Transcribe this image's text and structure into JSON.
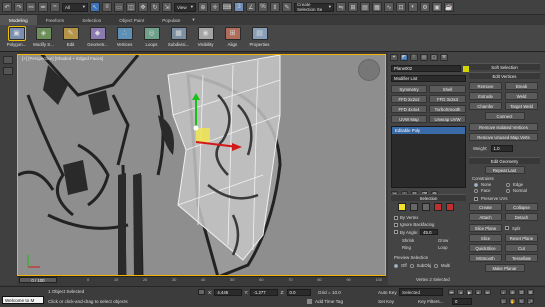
{
  "toolbar": {
    "filter_value": "All",
    "view_value": "View",
    "selection_set_value": "Create Selection Se",
    "filter_arrow": "▾",
    "view_arrow": "▾",
    "selection_arrow": "▾"
  },
  "ribbon_tabs": [
    "Modeling",
    "Freeform",
    "Selection",
    "Object Paint",
    "Populate"
  ],
  "ribbon_buttons": [
    {
      "label": "Polygon...",
      "icon": "polygon-modeling-icon",
      "color": "#7a8fb0",
      "glyph": "▣"
    },
    {
      "label": "Modify S...",
      "icon": "modify-selection-icon",
      "color": "#6d8f5a",
      "glyph": "◈"
    },
    {
      "label": "Edit",
      "icon": "edit-icon",
      "color": "#b59448",
      "glyph": "✎"
    },
    {
      "label": "Geometr...",
      "icon": "geometry-icon",
      "color": "#8a7ab0",
      "glyph": "◆"
    },
    {
      "label": "Vertices",
      "icon": "vertices-icon",
      "color": "#5e8fb5",
      "glyph": "∴"
    },
    {
      "label": "Loops",
      "icon": "loops-icon",
      "color": "#6fa08a",
      "glyph": "◎"
    },
    {
      "label": "Subdivisi...",
      "icon": "subdivision-icon",
      "color": "#7b8fa0",
      "glyph": "▦"
    },
    {
      "label": "Visibility",
      "icon": "visibility-icon",
      "color": "#a5a5a5",
      "glyph": "◉"
    },
    {
      "label": "Align",
      "icon": "align-icon",
      "color": "#b06d5a",
      "glyph": "⊞"
    },
    {
      "label": "Properties",
      "icon": "properties-icon",
      "color": "#8aa0b8",
      "glyph": "▤"
    }
  ],
  "viewport": {
    "label": "[+] [Perspective] [Shaded + Edged Faces]",
    "accent": "#f2b400"
  },
  "panel": {
    "object_name": "Plane002",
    "object_color": "#d4d400",
    "modifier_list": "Modifier List",
    "modifier_buttons": [
      "Symmetry",
      "Shell",
      "FFD 2x2x2",
      "FFD 3x3x3",
      "FFD 4x4x4",
      "TurboSmooth",
      "UVW Map",
      "Unwrap UVW"
    ],
    "stack_item": "Editable Poly",
    "selection_title": "Selection",
    "by_vertex": "By Vertex",
    "ignore_backfacing": "Ignore Backfacing",
    "by_angle": "By Angle:",
    "by_angle_value": "45.0",
    "shrink": "Shrink",
    "grow": "Grow",
    "ring": "Ring",
    "loop": "Loop",
    "preview_selection": "Preview Selection",
    "preview_off": "Off",
    "preview_subobj": "SubObj",
    "preview_multi": "Multi",
    "status": "Vertex 2 Selected",
    "soft_selection": "Soft Selection",
    "edit_vertices": "Edit Vertices",
    "remove": "Remove",
    "break": "Break",
    "extrude": "Extrude",
    "weld": "Weld",
    "chamfer": "Chamfer",
    "target_weld": "Target Weld",
    "connect": "Connect",
    "remove_isolated": "Remove Isolated Vertices",
    "remove_unused": "Remove Unused Map Verts",
    "weight_label": "Weight:",
    "weight_value": "1.0",
    "edit_geometry": "Edit Geometry",
    "repeat_last": "Repeat Last",
    "constraints": "Constraints",
    "c_none": "None",
    "c_edge": "Edge",
    "c_face": "Face",
    "c_normal": "Normal",
    "preserve_uvs": "Preserve UVs",
    "create": "Create",
    "collapse": "Collapse",
    "attach": "Attach",
    "detach": "Detach",
    "slice_plane": "Slice Plane",
    "split": "Split",
    "slice": "Slice",
    "reset_plane": "Reset Plane",
    "quickslice": "QuickSlice",
    "cut": "Cut",
    "msmooth": "MSmooth",
    "tessellate": "Tessellate",
    "make_planar": "Make Planar"
  },
  "timeline": {
    "position": "0 / 100",
    "ticks": [
      "0",
      "10",
      "20",
      "30",
      "40",
      "50",
      "60",
      "70",
      "80",
      "90",
      "100"
    ]
  },
  "status": {
    "maxscript": "Welcome to M",
    "selected": "1 Object Selected",
    "prompt": "Click or click-and-drag to select objects",
    "x_label": "X:",
    "x_value": "4.446",
    "y_label": "Y:",
    "y_value": "-1.277",
    "z_label": "Z:",
    "z_value": "0.0",
    "grid": "Grid = 10.0",
    "add_time_tag": "Add Time Tag",
    "auto_key": "Auto Key",
    "set_key": "Set Key",
    "selected_dropdown": "Selected",
    "key_filters": "Key Filters...",
    "frame": "0"
  }
}
